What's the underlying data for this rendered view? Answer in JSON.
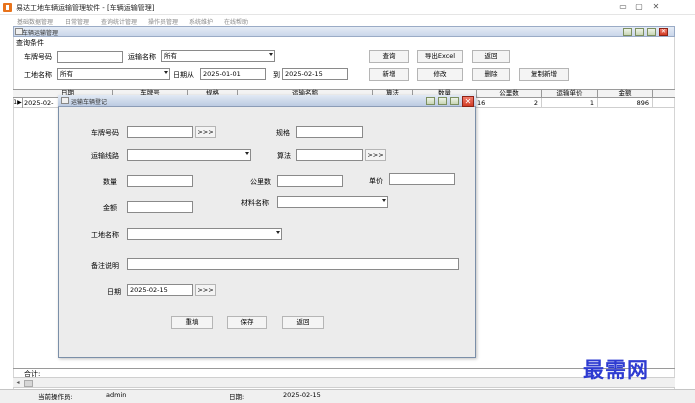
{
  "window": {
    "title": "易达工地车辆运输管理软件 - [车辆运输管理]",
    "minimize": "▭",
    "maximize": "▢",
    "close": "✕"
  },
  "menu": [
    "基础数据管理",
    "日常管理",
    "查询统计管理",
    "操作员管理",
    "系统维护",
    "在线帮助"
  ],
  "inner_window": {
    "title": "车辆运输管理",
    "section_label": "查询条件"
  },
  "query": {
    "plate_label": "车牌号码",
    "plate_value": "",
    "route_label": "运输名称",
    "route_value": "所有",
    "site_label": "工地名称",
    "site_value": "所有",
    "date_from_label": "日期从",
    "date_from": "2025-01-01",
    "date_to_label": "到",
    "date_to": "2025-02-15",
    "buttons": {
      "search": "查询",
      "export": "导出Excel",
      "back": "返回",
      "add": "新增",
      "edit": "修改",
      "delete": "删除",
      "copy_add": "复制新增"
    }
  },
  "grid": {
    "columns": [
      "日期",
      "车牌号",
      "规格",
      "运输名称",
      "算法",
      "数量",
      "公里数",
      "运输单价",
      "金额"
    ],
    "row_indicator": "1",
    "row": [
      "2025-02-",
      "",
      "",
      "",
      "",
      "16",
      "2",
      "1",
      "896"
    ],
    "total_label": "合计:"
  },
  "status": {
    "operator_label": "当前操作员:",
    "operator_value": "admin",
    "date_label": "日期:",
    "date_value": "2025-02-15"
  },
  "dialog": {
    "title": "运输车辆登记",
    "plate_label": "车牌号码",
    "plate_value": "",
    "picker": ">>>",
    "spec_label": "规格",
    "spec_value": "",
    "route_label": "运输线路",
    "route_value": "",
    "algo_label": "算法",
    "algo_value": "",
    "qty_label": "数量",
    "qty_value": "",
    "km_label": "公里数",
    "km_value": "",
    "price_label": "单价",
    "price_value": "",
    "amount_label": "金额",
    "amount_value": "",
    "material_label": "材料名称",
    "material_value": "",
    "site_label": "工地名称",
    "site_value": "",
    "remark_label": "备注说明",
    "remark_value": "",
    "date_label": "日期",
    "date_value": "2025-02-15",
    "buttons": {
      "reset": "重填",
      "save": "保存",
      "back": "返回"
    }
  },
  "watermark": "最需网"
}
